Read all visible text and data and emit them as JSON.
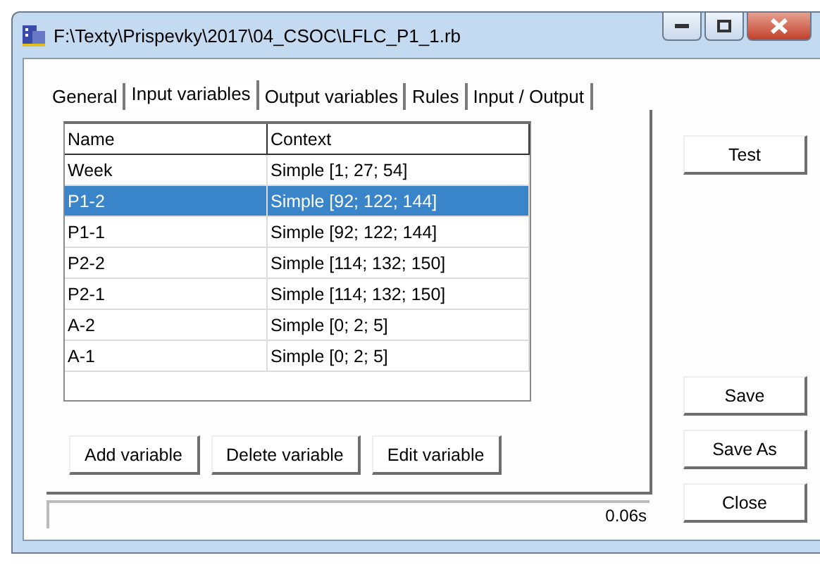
{
  "window": {
    "title": "F:\\Texty\\Prispevky\\2017\\04_CSOC\\LFLC_P1_1.rb"
  },
  "tabs": [
    {
      "label": "General",
      "selected": false
    },
    {
      "label": "Input variables",
      "selected": true
    },
    {
      "label": "Output variables",
      "selected": false
    },
    {
      "label": "Rules",
      "selected": false
    },
    {
      "label": "Input / Output",
      "selected": false
    }
  ],
  "table": {
    "columns": [
      "Name",
      "Context"
    ],
    "rows": [
      {
        "name": "Week",
        "context": "Simple [1; 27; 54]",
        "selected": false
      },
      {
        "name": "P1-2",
        "context": "Simple [92; 122; 144]",
        "selected": true
      },
      {
        "name": "P1-1",
        "context": "Simple [92; 122; 144]",
        "selected": false
      },
      {
        "name": "P2-2",
        "context": "Simple [114; 132; 150]",
        "selected": false
      },
      {
        "name": "P2-1",
        "context": "Simple [114; 132; 150]",
        "selected": false
      },
      {
        "name": "A-2",
        "context": "Simple [0; 2; 5]",
        "selected": false
      },
      {
        "name": "A-1",
        "context": "Simple [0; 2; 5]",
        "selected": false
      }
    ]
  },
  "panel_buttons": [
    "Add variable",
    "Delete variable",
    "Edit variable"
  ],
  "side_buttons_top": [
    "Test"
  ],
  "side_buttons_bottom": [
    "Save",
    "Save As",
    "Close"
  ],
  "status_bar": {
    "time": "0.06s"
  }
}
